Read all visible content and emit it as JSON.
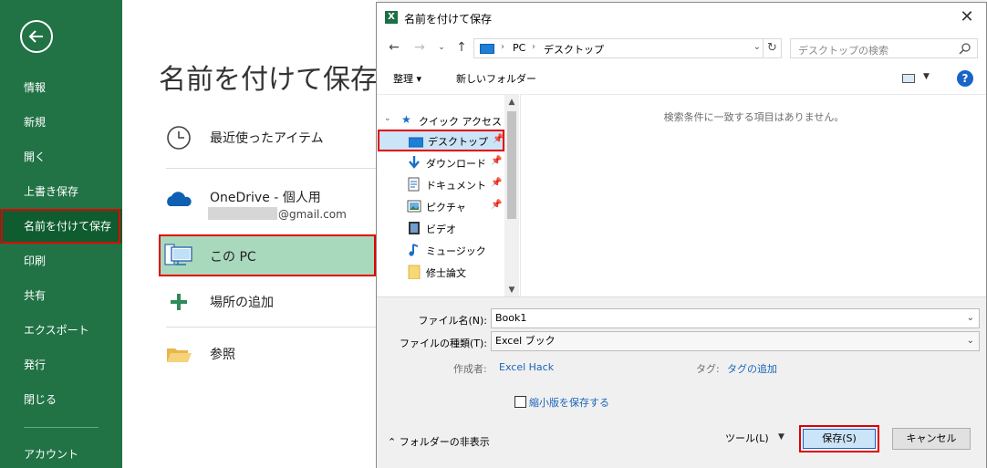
{
  "sidebar": {
    "items": [
      {
        "label": "情報"
      },
      {
        "label": "新規"
      },
      {
        "label": "開く"
      },
      {
        "label": "上書き保存"
      },
      {
        "label": "名前を付けて保存"
      },
      {
        "label": "印刷"
      },
      {
        "label": "共有"
      },
      {
        "label": "エクスポート"
      },
      {
        "label": "発行"
      },
      {
        "label": "閉じる"
      },
      {
        "label": "アカウント"
      }
    ],
    "active_item": "名前を付けて保存"
  },
  "backstage": {
    "title": "名前を付けて保存",
    "places": {
      "recent": "最近使ったアイテム",
      "onedrive": "OneDrive - 個人用",
      "onedrive_email": "@gmail.com",
      "this_pc": "この PC",
      "add_place": "場所の追加",
      "browse": "参照"
    }
  },
  "dialog": {
    "title": "名前を付けて保存",
    "app_icon_letter": "X",
    "breadcrumb": [
      "PC",
      "デスクトップ"
    ],
    "search_placeholder": "デスクトップの検索",
    "organize": "整理 ▾",
    "new_folder": "新しいフォルダー",
    "help": "?",
    "nav": {
      "quick_access": "クイック アクセス",
      "items": [
        {
          "label": "デスクトップ",
          "icon": "desktop-icon",
          "pinned": true
        },
        {
          "label": "ダウンロード",
          "icon": "download-icon",
          "pinned": true
        },
        {
          "label": "ドキュメント",
          "icon": "document-icon",
          "pinned": true
        },
        {
          "label": "ピクチャ",
          "icon": "picture-icon",
          "pinned": true
        },
        {
          "label": "ビデオ",
          "icon": "video-icon",
          "pinned": false
        },
        {
          "label": "ミュージック",
          "icon": "music-icon",
          "pinned": false
        },
        {
          "label": "修士論文",
          "icon": "folder-icon",
          "pinned": false
        }
      ]
    },
    "empty_message": "検索条件に一致する項目はありません。",
    "form": {
      "filename_label": "ファイル名(N):",
      "filename_value": "Book1",
      "filetype_label": "ファイルの種類(T):",
      "filetype_value": "Excel ブック",
      "author_label": "作成者:",
      "author_value": "Excel Hack",
      "tags_label": "タグ:",
      "tags_value": "タグの追加",
      "thumbnail_label": "縮小版を保存する",
      "hide_folders": "フォルダーの非表示",
      "tools": "ツール(L)",
      "save": "保存(S)",
      "cancel": "キャンセル"
    }
  },
  "colors": {
    "excel_green": "#217346",
    "highlight_red": "#e00000",
    "this_pc_bg": "#a9d9bd",
    "link_blue": "#1a65b8"
  }
}
